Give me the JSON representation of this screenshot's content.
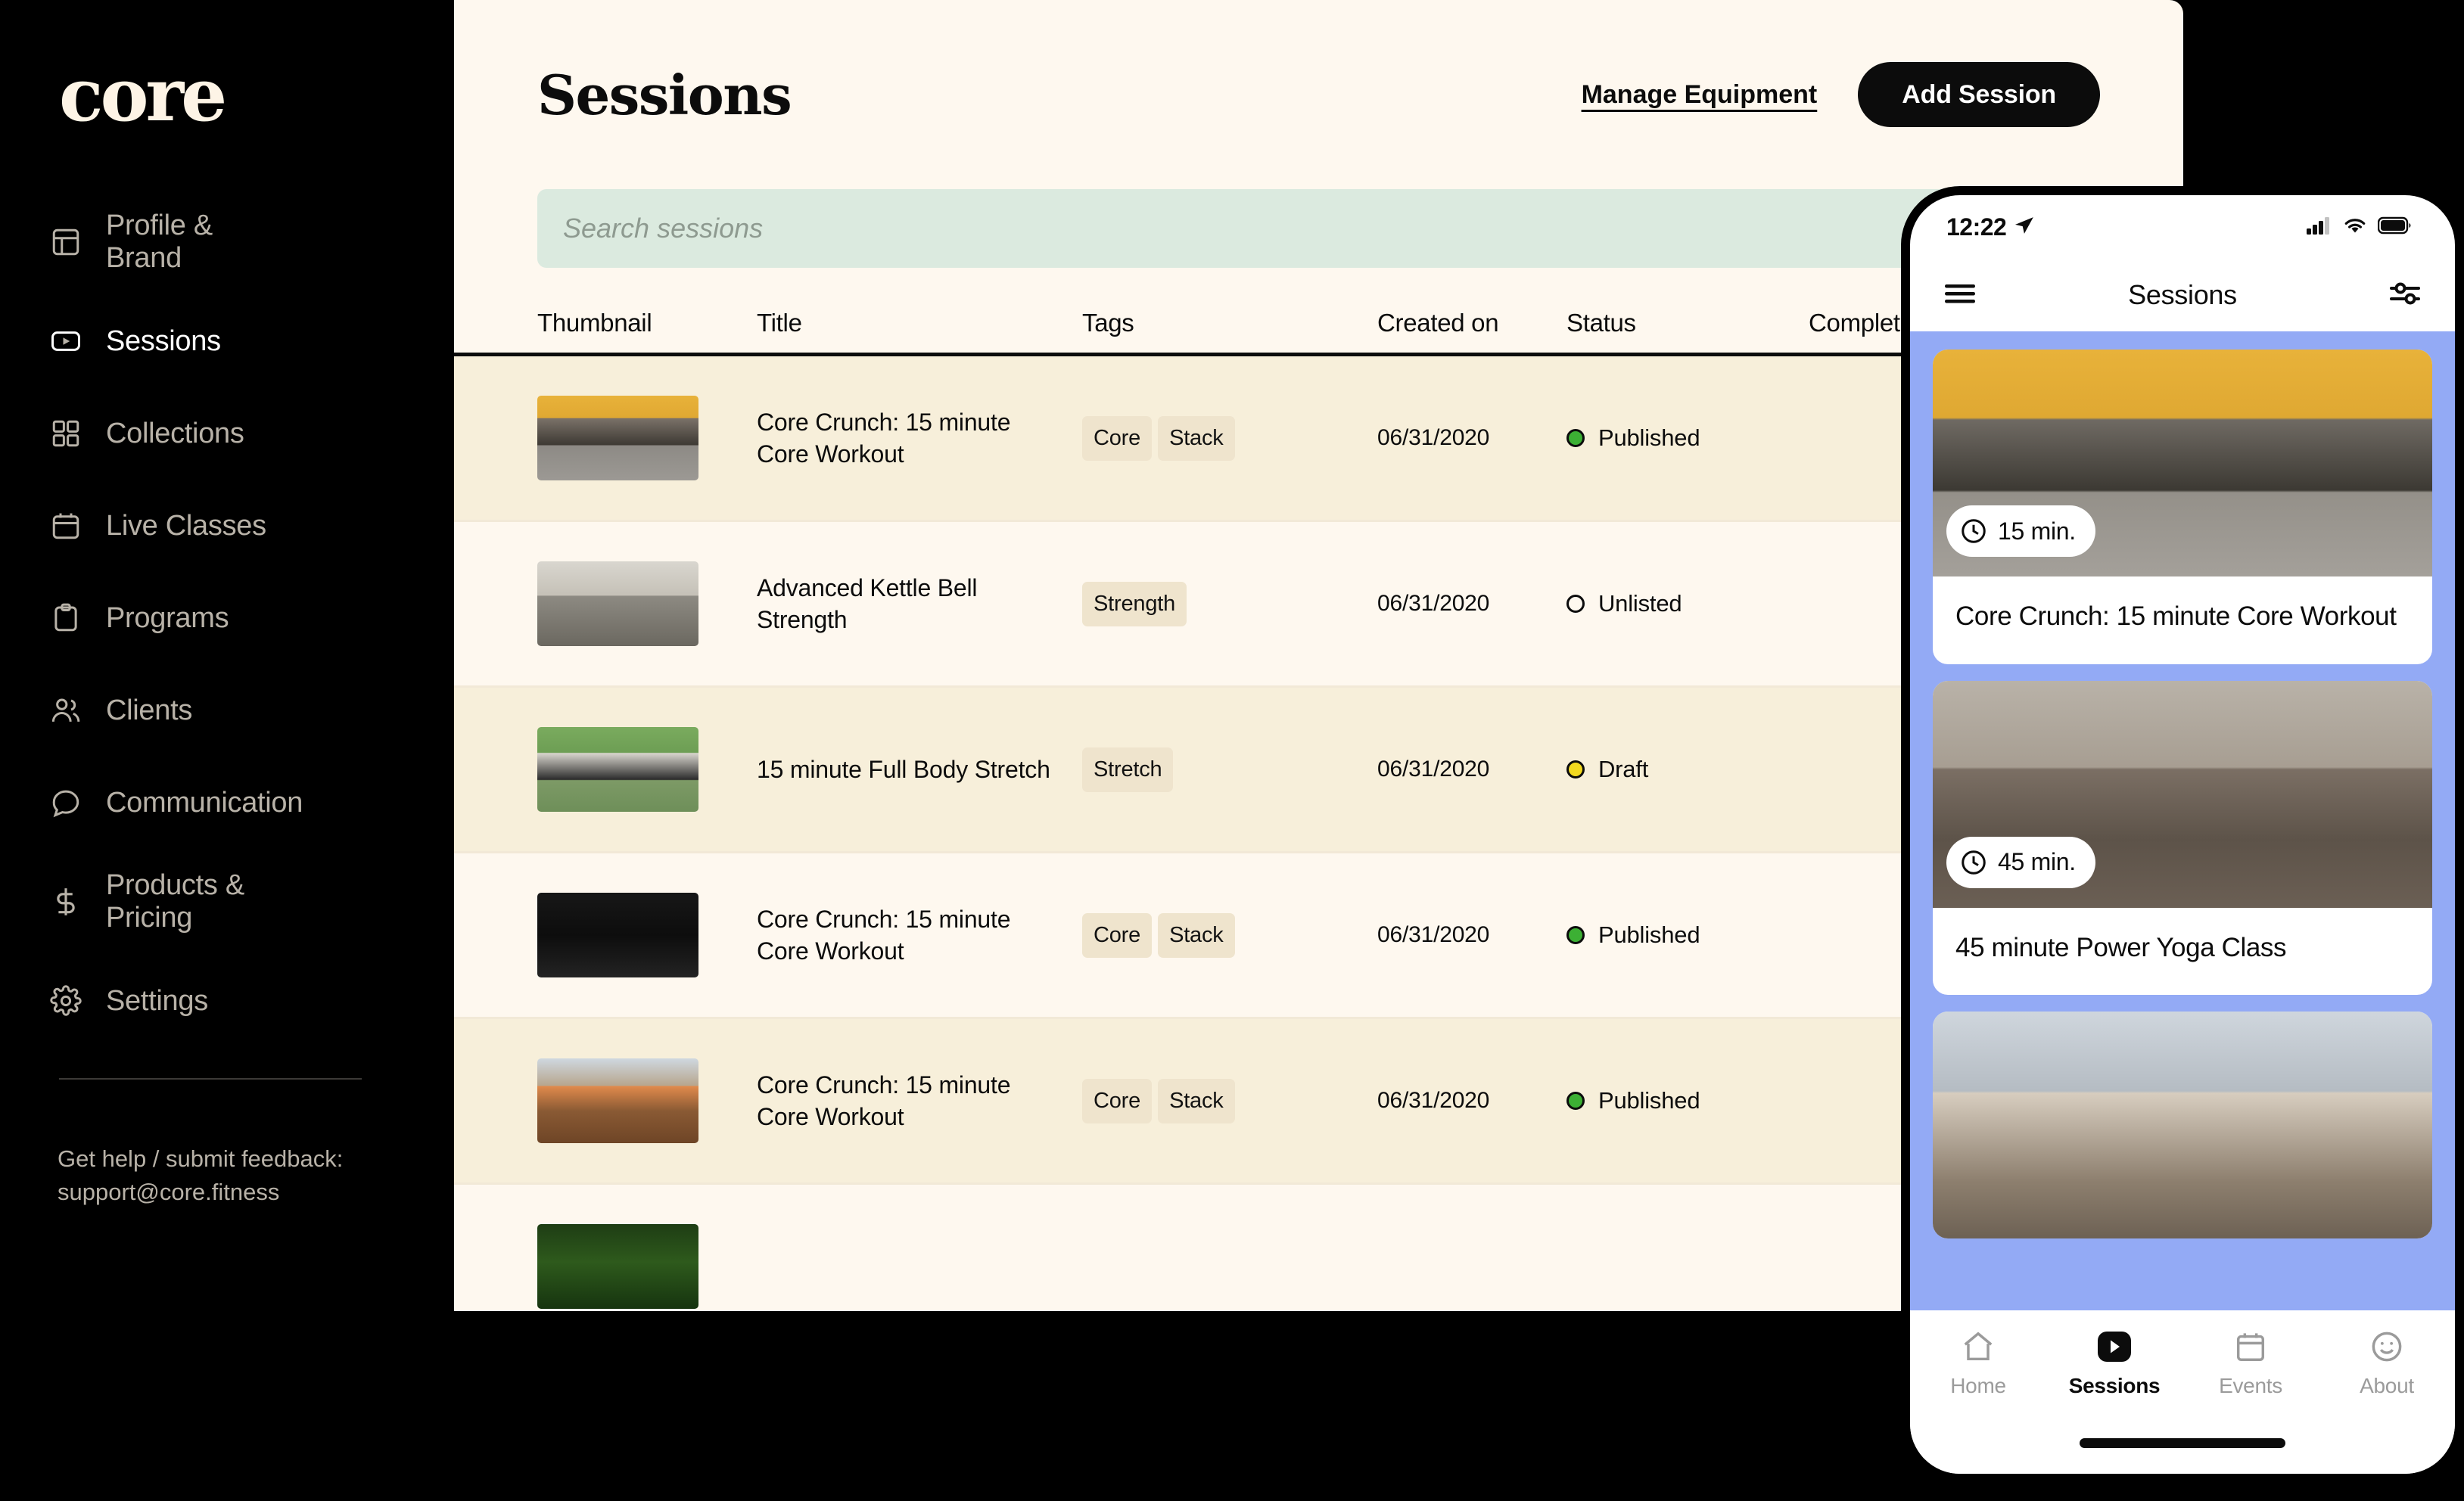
{
  "sidebar": {
    "logo": "core",
    "items": [
      {
        "label": "Profile & Brand",
        "icon": "layout-icon",
        "active": false
      },
      {
        "label": "Sessions",
        "icon": "video-icon",
        "active": true
      },
      {
        "label": "Collections",
        "icon": "grid-icon",
        "active": false
      },
      {
        "label": "Live Classes",
        "icon": "calendar-icon",
        "active": false
      },
      {
        "label": "Programs",
        "icon": "clipboard-icon",
        "active": false
      },
      {
        "label": "Clients",
        "icon": "users-icon",
        "active": false
      },
      {
        "label": "Communication",
        "icon": "chat-icon",
        "active": false
      },
      {
        "label": "Products & Pricing",
        "icon": "dollar-icon",
        "active": false
      },
      {
        "label": "Settings",
        "icon": "gear-icon",
        "active": false
      }
    ],
    "help_text": "Get help / submit feedback: support@core.fitness"
  },
  "header": {
    "title": "Sessions",
    "manage_equipment_label": "Manage Equipment",
    "add_session_label": "Add Session"
  },
  "search": {
    "placeholder": "Search sessions",
    "value": ""
  },
  "table": {
    "columns": [
      "Thumbnail",
      "Title",
      "Tags",
      "Created on",
      "Status",
      "Complete"
    ],
    "rows": [
      {
        "title": "Core Crunch: 15 minute Core Workout",
        "tags": [
          "Core",
          "Stack"
        ],
        "created_on": "06/31/2020",
        "status": "Published",
        "status_color": "#3cb034",
        "thumb_class": "tb0"
      },
      {
        "title": "Advanced Kettle Bell Strength",
        "tags": [
          "Strength"
        ],
        "created_on": "06/31/2020",
        "status": "Unlisted",
        "status_color": "#fef8ef",
        "thumb_class": "tb1"
      },
      {
        "title": "15 minute Full Body Stretch",
        "tags": [
          "Stretch"
        ],
        "created_on": "06/31/2020",
        "status": "Draft",
        "status_color": "#f2d91f",
        "thumb_class": "tb2"
      },
      {
        "title": "Core Crunch: 15 minute Core Workout",
        "tags": [
          "Core",
          "Stack"
        ],
        "created_on": "06/31/2020",
        "status": "Published",
        "status_color": "#3cb034",
        "thumb_class": "tb3"
      },
      {
        "title": "Core Crunch: 15 minute Core Workout",
        "tags": [
          "Core",
          "Stack"
        ],
        "created_on": "06/31/2020",
        "status": "Published",
        "status_color": "#3cb034",
        "thumb_class": "tb4"
      },
      {
        "title": "",
        "tags": [],
        "created_on": "",
        "status": "",
        "status_color": "#3cb034",
        "thumb_class": "tb5"
      }
    ]
  },
  "phone": {
    "status_bar": {
      "time": "12:22",
      "location_icon": "location-arrow-icon",
      "cellular_icon": "cellular-bars-icon",
      "wifi_icon": "wifi-icon",
      "battery_icon": "battery-icon"
    },
    "navbar": {
      "menu_icon": "hamburger-menu-icon",
      "title": "Sessions",
      "filter_icon": "sliders-filter-icon"
    },
    "cards": [
      {
        "duration": "15 min.",
        "title": "Core Crunch: 15 minute Core Workout",
        "img_class": "pi0"
      },
      {
        "duration": "45 min.",
        "title": "45 minute Power Yoga Class",
        "img_class": "pi1"
      },
      {
        "duration": "",
        "title": "",
        "img_class": "pi2"
      }
    ],
    "tabs": [
      {
        "label": "Home",
        "icon": "home-icon",
        "active": false
      },
      {
        "label": "Sessions",
        "icon": "video-icon",
        "active": true
      },
      {
        "label": "Events",
        "icon": "calendar-icon",
        "active": false
      },
      {
        "label": "About",
        "icon": "smiley-icon",
        "active": false
      }
    ]
  },
  "colors": {
    "panel_bg": "#fef8ef",
    "sidebar_bg": "#000000",
    "search_bg": "#dbeadf",
    "phone_bg": "#93aaf5",
    "tag_bg": "#efe4cd",
    "accent_published": "#3cb034",
    "accent_draft": "#f2d91f"
  }
}
